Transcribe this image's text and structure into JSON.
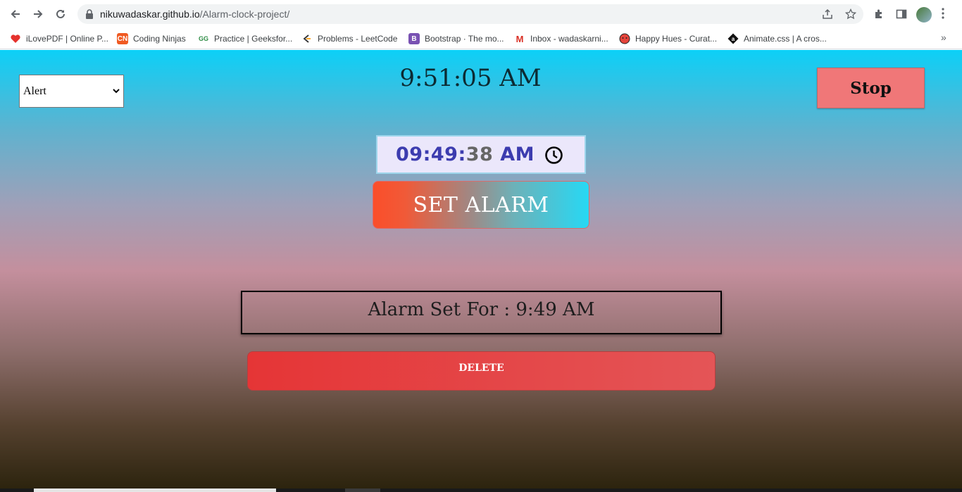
{
  "browser": {
    "url_host": "nikuwadaskar.github.io",
    "url_path": "/Alarm-clock-project/",
    "icons": [
      "back-arrow-icon",
      "forward-arrow-icon",
      "reload-icon",
      "lock-icon",
      "share-icon",
      "star-icon",
      "extensions-icon",
      "side-panel-icon",
      "profile-avatar",
      "menu-icon"
    ]
  },
  "bookmarks": [
    {
      "label": "iLovePDF | Online P...",
      "icon": "heart",
      "color": "#e5322d"
    },
    {
      "label": "Coding Ninjas",
      "icon": "CN",
      "color": "#f05a22"
    },
    {
      "label": "Practice | Geeksfor...",
      "icon": "GfG",
      "color": "#2f8d46"
    },
    {
      "label": "Problems - LeetCode",
      "icon": "LC",
      "color": "#ffa116"
    },
    {
      "label": "Bootstrap · The mo...",
      "icon": "B",
      "color": "#7952b3"
    },
    {
      "label": "Inbox - wadaskarni...",
      "icon": "M",
      "color": "#d93025"
    },
    {
      "label": "Happy Hues - Curat...",
      "icon": "face",
      "color": "#e5443b"
    },
    {
      "label": "Animate.css | A cros...",
      "icon": "a",
      "color": "#111111"
    }
  ],
  "app": {
    "select_value": "Alert",
    "current_time": "9:51:05 AM",
    "stop_label": "Stop",
    "time_input": {
      "hours_minutes": "09:49:",
      "seconds": "38",
      "period": "AM"
    },
    "set_alarm_label": "SET ALARM",
    "alarm_text": "Alarm Set For : 9:49 AM",
    "delete_label": "DELETE"
  },
  "colors": {
    "stop_button": "#f07778",
    "delete_button": "#e53536",
    "time_input_bg": "#ebe7fb",
    "time_input_text": "#3c3caf"
  }
}
